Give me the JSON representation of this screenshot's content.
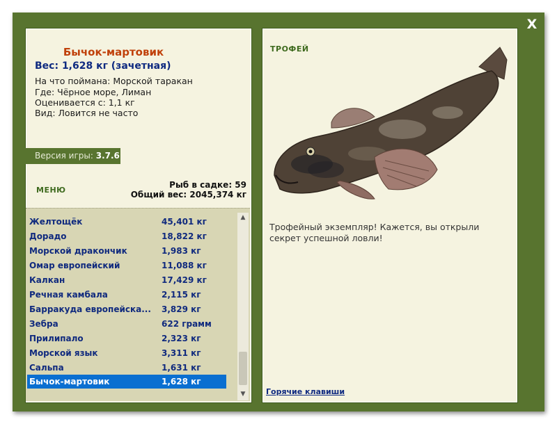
{
  "window": {
    "close_label": "X"
  },
  "fish": {
    "name": "Бычок-мартовик",
    "weight_line": "Вес: 1,628 кг (зачетная)",
    "bait": "На что поймана: Морской таракан",
    "where": "Где: Чёрное море, Лиман",
    "value": "Оценивается с: 1,1 кг",
    "kind": "Вид: Ловится не часто"
  },
  "version": {
    "label": "Версия игры:",
    "value": "3.7.6"
  },
  "menu_label": "МЕНЮ",
  "stats": {
    "fish_count": "Рыб в садке: 59",
    "total_weight": "Общий вес: 2045,374 кг"
  },
  "catch_list": [
    {
      "name": "Желтощёк",
      "weight": "45,401 кг"
    },
    {
      "name": "Дорадо",
      "weight": "18,822 кг"
    },
    {
      "name": "Морской дракончик",
      "weight": "1,983 кг"
    },
    {
      "name": "Омар европейский",
      "weight": "11,088 кг"
    },
    {
      "name": "Калкан",
      "weight": "17,429 кг"
    },
    {
      "name": "Речная камбала",
      "weight": "2,115 кг"
    },
    {
      "name": "Барракуда европейска...",
      "weight": "3,829 кг"
    },
    {
      "name": "Зебра",
      "weight": "622 грамм"
    },
    {
      "name": "Прилипало",
      "weight": "2,323 кг"
    },
    {
      "name": "Морской язык",
      "weight": "3,311 кг"
    },
    {
      "name": "Сальпа",
      "weight": "1,631 кг"
    },
    {
      "name": "Бычок-мартовик",
      "weight": "1,628 кг"
    }
  ],
  "selected_index": 11,
  "trophy": {
    "title": "ТРОФЕЙ",
    "text": "Трофейный экземпляр! Кажется, вы открыли секрет успешной ловли!"
  },
  "hotkeys_label": "Горячие клавиши",
  "colors": {
    "frame": "#58742f",
    "panel": "#f5f3e0",
    "list_bg": "#d8d6b4",
    "selected": "#0a6fd1",
    "fish_name": "#c0400a"
  }
}
